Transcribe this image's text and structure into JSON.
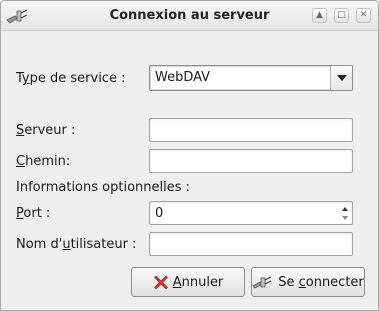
{
  "window": {
    "title": "Connexion au serveur",
    "app_icon": "plug-icon",
    "controls": [
      "maximize-icon",
      "restore-icon",
      "close-icon"
    ]
  },
  "form": {
    "service_type": {
      "label_prefix": "T",
      "label_accel": "y",
      "label_rest": "pe de service :",
      "value": "WebDAV"
    },
    "server": {
      "label_accel": "S",
      "label_rest": "erveur :",
      "value": ""
    },
    "path": {
      "label_accel": "C",
      "label_rest": "hemin:",
      "value": ""
    },
    "optional_info_label": "Informations optionnelles :",
    "port": {
      "label_accel": "P",
      "label_rest": "ort :",
      "value": "0"
    },
    "username": {
      "label_prefix": "Nom d'",
      "label_accel": "u",
      "label_rest": "tilisateur :",
      "value": ""
    }
  },
  "buttons": {
    "cancel": {
      "accel": "A",
      "rest": "nnuler",
      "icon": "cancel-x-icon"
    },
    "connect": {
      "prefix": "Se ",
      "accel": "c",
      "rest": "onnecter",
      "icon": "plug-icon"
    }
  }
}
